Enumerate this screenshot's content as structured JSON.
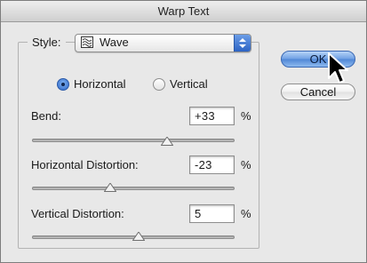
{
  "window": {
    "title": "Warp Text"
  },
  "style": {
    "label": "Style:",
    "selected": "Wave",
    "icon": "wave-icon"
  },
  "orientation": {
    "options": [
      {
        "label": "Horizontal",
        "selected": true
      },
      {
        "label": "Vertical",
        "selected": false
      }
    ]
  },
  "fields": [
    {
      "label": "Bend:",
      "value": "+33",
      "unit": "%",
      "slider_value": 33,
      "slider_range": [
        -100,
        100
      ]
    },
    {
      "label": "Horizontal Distortion:",
      "value": "-23",
      "unit": "%",
      "slider_value": -23,
      "slider_range": [
        -100,
        100
      ]
    },
    {
      "label": "Vertical Distortion:",
      "value": "5",
      "unit": "%",
      "slider_value": 5,
      "slider_range": [
        -100,
        100
      ]
    }
  ],
  "buttons": {
    "ok": "OK",
    "cancel": "Cancel"
  },
  "colors": {
    "accent": "#3a75d6",
    "dialog_bg": "#e8e8e8"
  }
}
